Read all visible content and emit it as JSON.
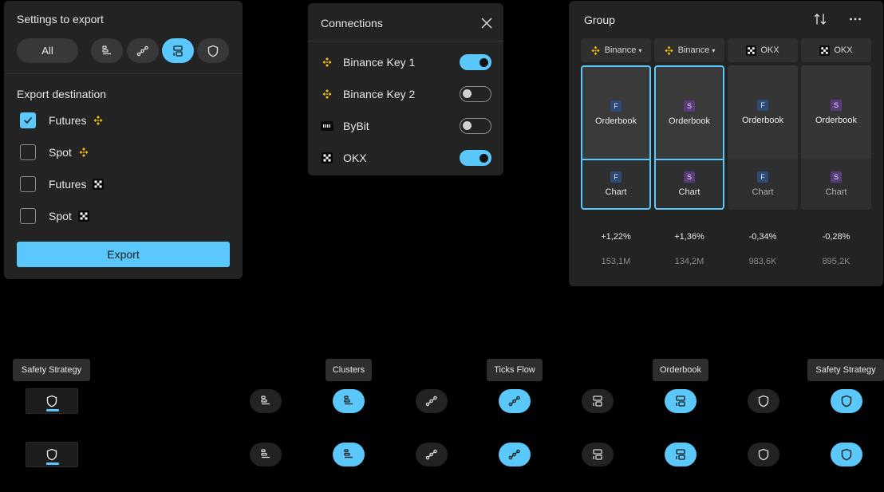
{
  "settings": {
    "title": "Settings to export",
    "all_label": "All",
    "type_buttons": [
      {
        "icon": "clusters-icon",
        "active": false
      },
      {
        "icon": "ticks-flow-icon",
        "active": false
      },
      {
        "icon": "orderbook-icon",
        "active": true
      },
      {
        "icon": "safety-strategy-icon",
        "active": false
      }
    ],
    "destination_title": "Export destination",
    "destinations": [
      {
        "label": "Futures",
        "exchange": "binance",
        "checked": true
      },
      {
        "label": "Spot",
        "exchange": "binance",
        "checked": false
      },
      {
        "label": "Futures",
        "exchange": "okx",
        "checked": false
      },
      {
        "label": "Spot",
        "exchange": "okx",
        "checked": false
      }
    ],
    "export_label": "Export"
  },
  "connections": {
    "title": "Connections",
    "items": [
      {
        "label": "Binance Key 1",
        "exchange": "binance",
        "on": true
      },
      {
        "label": "Binance Key 2",
        "exchange": "binance",
        "on": false
      },
      {
        "label": "ByBit",
        "exchange": "bybit",
        "on": false
      },
      {
        "label": "OKX",
        "exchange": "okx",
        "on": true
      }
    ]
  },
  "group": {
    "title": "Group",
    "columns": [
      {
        "exchange": "Binance",
        "logo": "binance",
        "dropdown": true,
        "tag": "F",
        "top": "Orderbook",
        "bottom": "Chart",
        "selected": true,
        "change": "+1,22%",
        "volume": "153,1M"
      },
      {
        "exchange": "Binance",
        "logo": "binance",
        "dropdown": true,
        "tag": "S",
        "top": "Orderbook",
        "bottom": "Chart",
        "selected": true,
        "change": "+1,36%",
        "volume": "134,2M"
      },
      {
        "exchange": "OKX",
        "logo": "okx",
        "dropdown": false,
        "tag": "F",
        "top": "Orderbook",
        "bottom": "Chart",
        "selected": false,
        "change": "-0,34%",
        "volume": "983,6K"
      },
      {
        "exchange": "OKX",
        "logo": "okx",
        "dropdown": false,
        "tag": "S",
        "top": "Orderbook",
        "bottom": "Chart",
        "selected": false,
        "change": "-0,28%",
        "volume": "895,2K"
      }
    ]
  },
  "tooltips": {
    "safety_left": "Safety Strategy",
    "clusters": "Clusters",
    "ticks_flow": "Ticks Flow",
    "orderbook": "Orderbook",
    "safety_right": "Safety Strategy"
  },
  "colors": {
    "accent": "#5ac8fa",
    "binance": "#f0b90b",
    "panel": "#232323"
  }
}
